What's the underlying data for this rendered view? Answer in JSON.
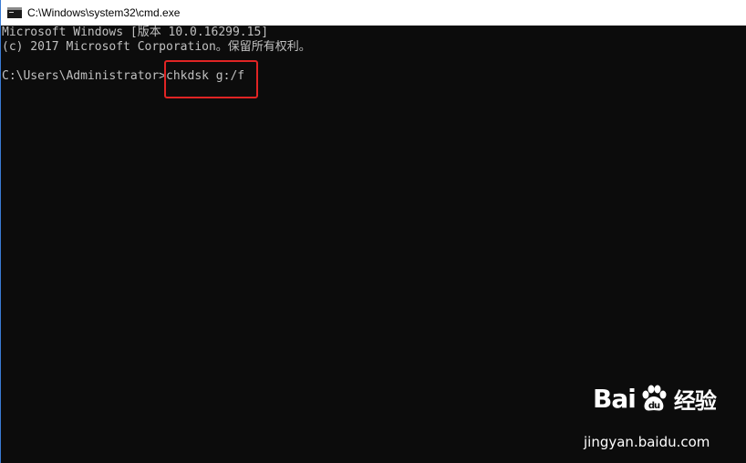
{
  "window": {
    "title": "C:\\Windows\\system32\\cmd.exe",
    "icon": "cmd-icon"
  },
  "console": {
    "lines": [
      "Microsoft Windows [版本 10.0.16299.15]",
      "(c) 2017 Microsoft Corporation。保留所有权利。",
      "",
      "C:\\Users\\Administrator>chkdsk g:/f"
    ]
  },
  "annotation": {
    "color": "#e02424"
  },
  "watermark": {
    "logo_left": "Bai",
    "logo_right": "经验",
    "url": "jingyan.baidu.com",
    "icon": "baidu-paw-icon"
  },
  "colors": {
    "console_bg": "#0c0c0c",
    "console_text": "#c0c0c0",
    "titlebar_bg": "#ffffff"
  }
}
